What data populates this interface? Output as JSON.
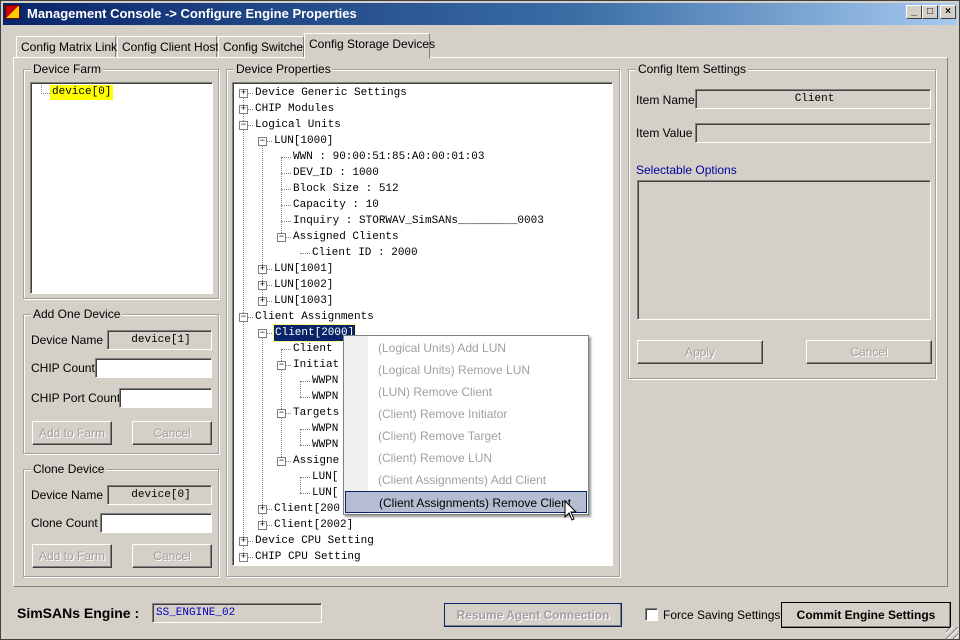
{
  "window": {
    "title": "Management Console -> Configure Engine Properties",
    "controls": [
      "_",
      "□",
      "×"
    ]
  },
  "tabs": [
    "Config Matrix Links",
    "Config Client Hosts",
    "Config Switches",
    "Config Storage Devices"
  ],
  "device_farm": {
    "legend": "Device Farm",
    "items": [
      "device[0]"
    ]
  },
  "add_device": {
    "legend": "Add One Device",
    "device_name_label": "Device Name",
    "device_name_value": "device[1]",
    "chip_count_label": "CHIP Count",
    "chip_count_value": "",
    "chip_port_count_label": "CHIP Port Count",
    "chip_port_count_value": "",
    "add_button": "Add to Farm",
    "cancel_button": "Cancel"
  },
  "clone_device": {
    "legend": "Clone Device",
    "device_name_label": "Device Name",
    "device_name_value": "device[0]",
    "clone_count_label": "Clone Count",
    "clone_count_value": "",
    "add_button": "Add to Farm",
    "cancel_button": "Cancel"
  },
  "device_properties": {
    "legend": "Device Properties",
    "tree": [
      {
        "text": "Device Generic Settings",
        "level": 0,
        "toggle": "+"
      },
      {
        "text": "CHIP Modules",
        "level": 0,
        "toggle": "+"
      },
      {
        "text": "Logical Units",
        "level": 0,
        "toggle": "-"
      },
      {
        "text": "LUN[1000]",
        "level": 1,
        "toggle": "-"
      },
      {
        "text": "WWN : 90:00:51:85:A0:00:01:03",
        "level": 2,
        "toggle": ""
      },
      {
        "text": "DEV_ID : 1000",
        "level": 2,
        "toggle": ""
      },
      {
        "text": "Block Size : 512",
        "level": 2,
        "toggle": ""
      },
      {
        "text": "Capacity : 10",
        "level": 2,
        "toggle": ""
      },
      {
        "text": "Inquiry : STORWAV_SimSANs_________0003",
        "level": 2,
        "toggle": ""
      },
      {
        "text": "Assigned Clients",
        "level": 2,
        "toggle": "-"
      },
      {
        "text": "Client ID : 2000",
        "level": 3,
        "toggle": ""
      },
      {
        "text": "LUN[1001]",
        "level": 1,
        "toggle": "+"
      },
      {
        "text": "LUN[1002]",
        "level": 1,
        "toggle": "+"
      },
      {
        "text": "LUN[1003]",
        "level": 1,
        "toggle": "+"
      },
      {
        "text": "Client Assignments",
        "level": 0,
        "toggle": "-"
      },
      {
        "text": "Client[2000]",
        "level": 1,
        "toggle": "-"
      },
      {
        "text": "Client",
        "level": 2,
        "toggle": ""
      },
      {
        "text": "Initiat",
        "level": 2,
        "toggle": "-"
      },
      {
        "text": "WWPN",
        "level": 3,
        "toggle": ""
      },
      {
        "text": "WWPN",
        "level": 3,
        "toggle": ""
      },
      {
        "text": "Targets",
        "level": 2,
        "toggle": "-"
      },
      {
        "text": "WWPN",
        "level": 3,
        "toggle": ""
      },
      {
        "text": "WWPN",
        "level": 3,
        "toggle": ""
      },
      {
        "text": "Assigne",
        "level": 2,
        "toggle": "-"
      },
      {
        "text": "LUN[",
        "level": 3,
        "toggle": ""
      },
      {
        "text": "LUN[",
        "level": 3,
        "toggle": ""
      },
      {
        "text": "Client[200",
        "level": 1,
        "toggle": "+"
      },
      {
        "text": "Client[2002]",
        "level": 1,
        "toggle": "+"
      },
      {
        "text": "Device CPU Setting",
        "level": 0,
        "toggle": "+"
      },
      {
        "text": "CHIP CPU Setting",
        "level": 0,
        "toggle": "+"
      }
    ],
    "selected_index": 15
  },
  "context_menu": {
    "items": [
      "(Logical Units) Add LUN",
      "(Logical Units) Remove LUN",
      "(LUN) Remove Client",
      "(Client) Remove Initiator",
      "(Client) Remove Target",
      "(Client) Remove LUN",
      "(Client Assignments) Add Client",
      "(Client Assignments) Remove Client"
    ],
    "highlighted_index": 7
  },
  "config_item": {
    "legend": "Config Item Settings",
    "item_name_label": "Item Name",
    "item_name_value": "Client",
    "item_value_label": "Item Value",
    "item_value_value": "",
    "selectable_options_label": "Selectable Options",
    "apply_button": "Apply",
    "cancel_button": "Cancel"
  },
  "status": {
    "engine_label": "SimSANs Engine :",
    "engine_value": "SS_ENGINE_02",
    "resume_button": "Resume Agent Connection",
    "force_saving_label": "Force Saving Settings",
    "force_saving_checked": false,
    "commit_button": "Commit Engine Settings"
  },
  "colors": {
    "title_start": "#0a246a",
    "title_end": "#a6caf0",
    "face": "#d4d0c8",
    "highlight": "#ffff00",
    "selection": "#0a246a",
    "options_label": "#0000a0"
  }
}
